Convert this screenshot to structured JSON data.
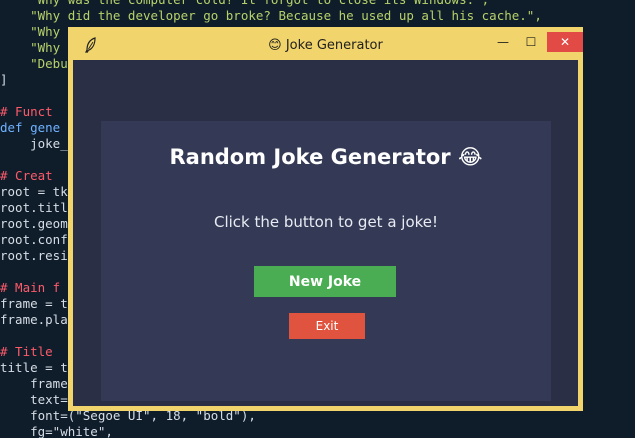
{
  "editor": {
    "lines": [
      {
        "text": "    \"Why was the computer cold? It forgot to close its Windows.\",",
        "cls": "str"
      },
      {
        "text": "    \"Why did the developer go broke? Because he used up all his cache.\",",
        "cls": "str"
      },
      {
        "text": "    \"Why",
        "cls": "str"
      },
      {
        "text": "    \"Why                                                          Express",
        "cls": "str"
      },
      {
        "text": "    \"Debu                                                          he murd",
        "cls": "str"
      },
      {
        "text": "]",
        "cls": ""
      },
      {
        "text": "",
        "cls": ""
      },
      {
        "text": "# Funct",
        "cls": "cm"
      },
      {
        "text": "def gene",
        "cls": "kw"
      },
      {
        "text": "    joke_",
        "cls": ""
      },
      {
        "text": "",
        "cls": ""
      },
      {
        "text": "# Creat",
        "cls": "cm"
      },
      {
        "text": "root = tk",
        "cls": ""
      },
      {
        "text": "root.titl",
        "cls": ""
      },
      {
        "text": "root.geom",
        "cls": ""
      },
      {
        "text": "root.conf",
        "cls": ""
      },
      {
        "text": "root.resi",
        "cls": ""
      },
      {
        "text": "",
        "cls": ""
      },
      {
        "text": "# Main f",
        "cls": "cm"
      },
      {
        "text": "frame = t",
        "cls": ""
      },
      {
        "text": "frame.pla",
        "cls": ""
      },
      {
        "text": "",
        "cls": ""
      },
      {
        "text": "# Title",
        "cls": "cm"
      },
      {
        "text": "title = t",
        "cls": ""
      },
      {
        "text": "    frame",
        "cls": ""
      },
      {
        "text": "    text=",
        "cls": ""
      },
      {
        "text": "    font=(\"Segoe UI\", 18, \"bold\"),",
        "cls": ""
      },
      {
        "text": "    fg=\"white\",",
        "cls": ""
      }
    ]
  },
  "window": {
    "title": "😊 Joke Generator",
    "minimize_glyph": "—",
    "maximize_glyph": "☐",
    "close_glyph": "✕"
  },
  "app": {
    "heading": "Random Joke Generator 😂",
    "prompt": "Click the button to get a joke!",
    "new_joke_label": "New Joke",
    "exit_label": "Exit"
  },
  "colors": {
    "window_border": "#f1d46b",
    "window_bg": "#2a2f45",
    "panel_bg": "#343a55",
    "new_joke_button": "#4bad53",
    "exit_button": "#e0533f"
  }
}
